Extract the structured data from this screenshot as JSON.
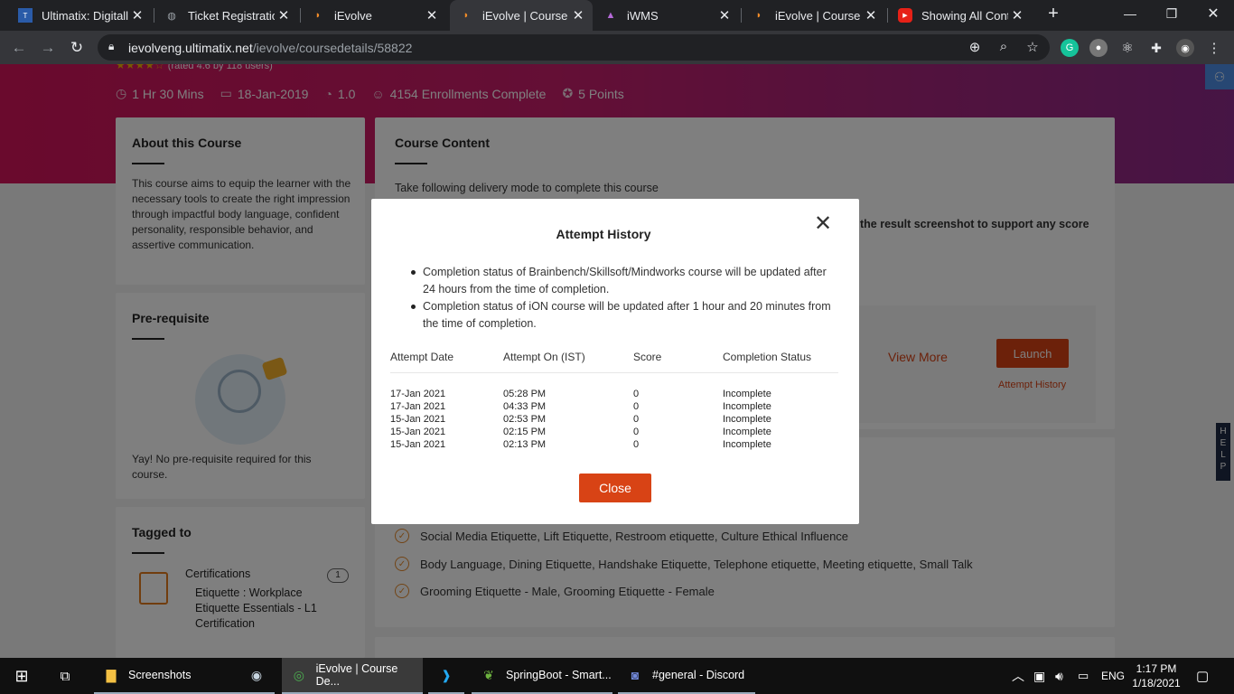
{
  "browser": {
    "tabs": [
      {
        "title": "Ultimatix: Digitally",
        "icon": "tata-icon"
      },
      {
        "title": "Ticket Registration",
        "icon": "globe-icon"
      },
      {
        "title": "iEvolve",
        "icon": "ievolve-icon"
      },
      {
        "title": "iEvolve | Course De",
        "icon": "ievolve-icon",
        "active": true
      },
      {
        "title": "iWMS",
        "icon": "iwms-icon"
      },
      {
        "title": "iEvolve | Course De",
        "icon": "ievolve-icon"
      },
      {
        "title": "Showing All Conta",
        "icon": "youtube-icon"
      }
    ],
    "url_host": "ievolveng.ultimatix.net",
    "url_path": "/ievolve/coursedetails/58822"
  },
  "course": {
    "rated": "(rated 4.6 by 118 users)",
    "duration": "1 Hr 30 Mins",
    "date": "18-Jan-2019",
    "version": "1.0",
    "enrollments": "4154 Enrollments Complete",
    "points": "5 Points"
  },
  "about": {
    "title": "About this Course",
    "text": "This course aims to equip the learner with the necessary tools to create the right impression through impactful body language, confident personality, responsible behavior, and assertive communication."
  },
  "prereq": {
    "title": "Pre-requisite",
    "text": "Yay! No pre-requisite required for this course."
  },
  "tagged": {
    "title": "Tagged to",
    "category": "Certifications",
    "count": "1",
    "item": "Etiquette : Workplace Etiquette Essentials - L1 Certification"
  },
  "content": {
    "title": "Course Content",
    "delivery": "Take following delivery mode to complete this course",
    "partial": "the result screenshot to support any score",
    "view_more": "View More",
    "launch": "Launch",
    "attempt_history": "Attempt History",
    "topics": [
      "Social Media Etiquette, Lift Etiquette, Restroom etiquette, Culture Ethical Influence",
      "Body Language, Dining Etiquette, Handshake Etiquette, Telephone etiquette, Meeting etiquette, Small Talk",
      "Grooming Etiquette - Male, Grooming Etiquette - Female"
    ]
  },
  "help": "HELP",
  "modal": {
    "title": "Attempt History",
    "notes": [
      "Completion status of Brainbench/Skillsoft/Mindworks course will be updated after 24 hours from the time of completion.",
      "Completion status of iON course will be updated after 1 hour and 20 minutes from the time of completion."
    ],
    "headers": [
      "Attempt Date",
      "Attempt On (IST)",
      "Score",
      "Completion Status"
    ],
    "rows": [
      [
        "17-Jan 2021",
        "05:28 PM",
        "0",
        "Incomplete"
      ],
      [
        "17-Jan 2021",
        "04:33 PM",
        "0",
        "Incomplete"
      ],
      [
        "15-Jan 2021",
        "02:53 PM",
        "0",
        "Incomplete"
      ],
      [
        "15-Jan 2021",
        "02:15 PM",
        "0",
        "Incomplete"
      ],
      [
        "15-Jan 2021",
        "02:13 PM",
        "0",
        "Incomplete"
      ]
    ],
    "close": "Close"
  },
  "taskbar": {
    "items": [
      {
        "label": "Screenshots",
        "icon": "folder-icon"
      },
      {
        "label": "",
        "icon": "steam-icon"
      },
      {
        "label": "iEvolve | Course De...",
        "icon": "chrome-icon"
      },
      {
        "label": "",
        "icon": "vscode-icon"
      },
      {
        "label": "SpringBoot - Smart...",
        "icon": "spring-icon"
      },
      {
        "label": "#general - Discord",
        "icon": "discord-icon"
      }
    ],
    "lang": "ENG",
    "time": "1:17 PM",
    "date": "1/18/2021"
  }
}
